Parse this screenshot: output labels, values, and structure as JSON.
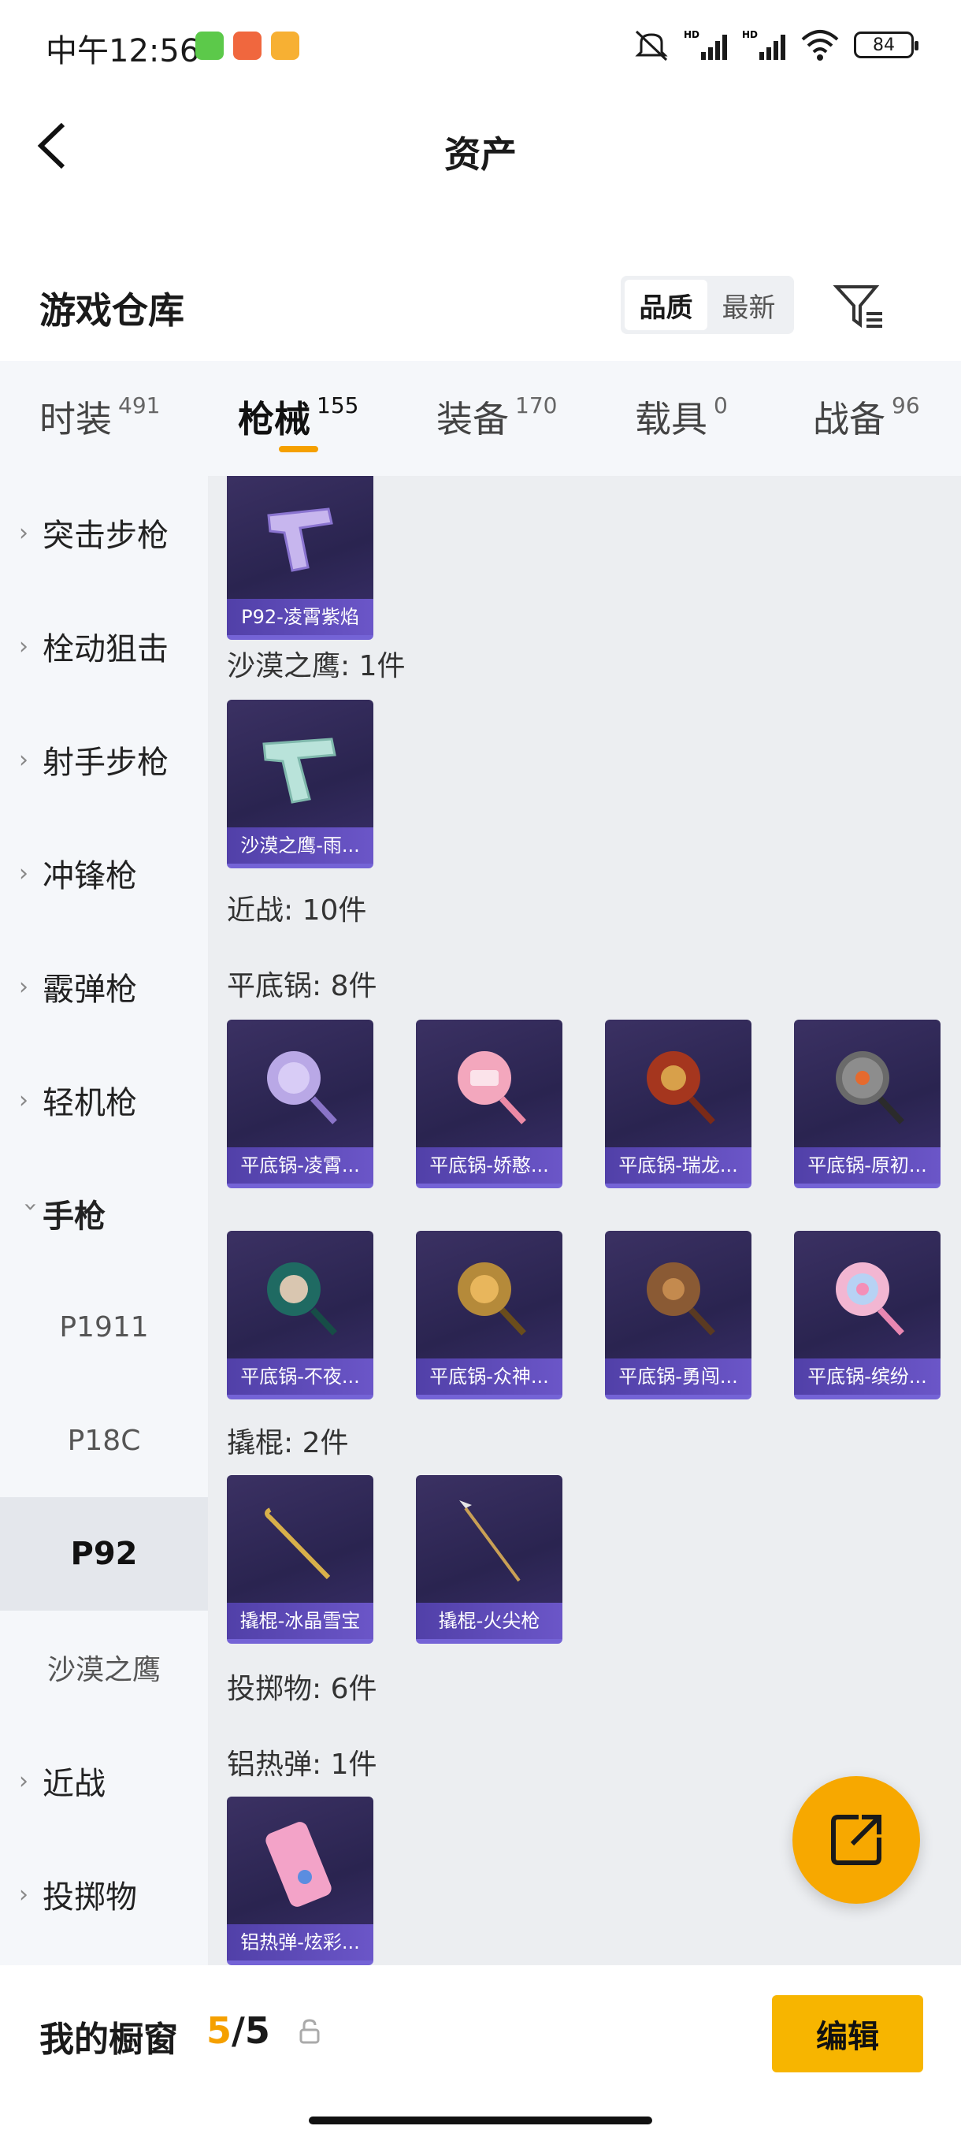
{
  "status_bar": {
    "time": "中午12:56",
    "battery": "84",
    "app_icon_colors": [
      "#5cc94a",
      "#f0673e",
      "#f7b033"
    ]
  },
  "header": {
    "title": "资产"
  },
  "warehouse": {
    "title": "游戏仓库",
    "sort_options": [
      "品质",
      "最新"
    ],
    "active_sort": "品质"
  },
  "tabs": [
    {
      "name": "时装",
      "count": "491"
    },
    {
      "name": "枪械",
      "count": "155"
    },
    {
      "name": "装备",
      "count": "170"
    },
    {
      "name": "载具",
      "count": "0"
    },
    {
      "name": "战备",
      "count": "96"
    }
  ],
  "active_tab": "枪械",
  "side_nav": [
    {
      "label": "突击步枪",
      "kind": "collapsed"
    },
    {
      "label": "栓动狙击",
      "kind": "collapsed"
    },
    {
      "label": "射手步枪",
      "kind": "collapsed"
    },
    {
      "label": "冲锋枪",
      "kind": "collapsed"
    },
    {
      "label": "霰弹枪",
      "kind": "collapsed"
    },
    {
      "label": "轻机枪",
      "kind": "collapsed"
    },
    {
      "label": "手枪",
      "kind": "open"
    },
    {
      "label": "P1911",
      "kind": "sub"
    },
    {
      "label": "P18C",
      "kind": "sub"
    },
    {
      "label": "P92",
      "kind": "sub-selected"
    },
    {
      "label": "沙漠之鹰",
      "kind": "sub"
    },
    {
      "label": "近战",
      "kind": "collapsed"
    },
    {
      "label": "投掷物",
      "kind": "collapsed"
    }
  ],
  "content": {
    "p92_items": [
      {
        "name": "P92-凌霄紫焰",
        "art": "pistol-purple"
      }
    ],
    "deagle_label": "沙漠之鹰: 1件",
    "deagle_items": [
      {
        "name": "沙漠之鹰-雨...",
        "art": "pistol-mint"
      }
    ],
    "melee_label": "近战: 10件",
    "pan_label": "平底锅: 8件",
    "pan_items": [
      {
        "name": "平底锅-凌霄...",
        "art": "pan-lavender"
      },
      {
        "name": "平底锅-娇憨...",
        "art": "pan-pink"
      },
      {
        "name": "平底锅-瑞龙...",
        "art": "pan-red"
      },
      {
        "name": "平底锅-原初...",
        "art": "pan-grey"
      },
      {
        "name": "平底锅-不夜...",
        "art": "pan-teal"
      },
      {
        "name": "平底锅-众神...",
        "art": "pan-gold"
      },
      {
        "name": "平底锅-勇闯...",
        "art": "pan-bronze"
      },
      {
        "name": "平底锅-缤纷...",
        "art": "pan-candy"
      }
    ],
    "crowbar_label": "撬棍: 2件",
    "crowbar_items": [
      {
        "name": "撬棍-冰晶雪宝",
        "art": "crowbar-gold"
      },
      {
        "name": "撬棍-火尖枪",
        "art": "spear"
      }
    ],
    "throw_label": "投掷物: 6件",
    "thermite_label": "铝热弹: 1件",
    "thermite_items": [
      {
        "name": "铝热弹-炫彩...",
        "art": "thermite-pink"
      }
    ]
  },
  "bottom_bar": {
    "label": "我的橱窗",
    "count_current": "5",
    "count_total": "/5",
    "edit_label": "编辑"
  },
  "colors": {
    "accent": "#f5a000",
    "card_caption": "#5a46b8"
  }
}
